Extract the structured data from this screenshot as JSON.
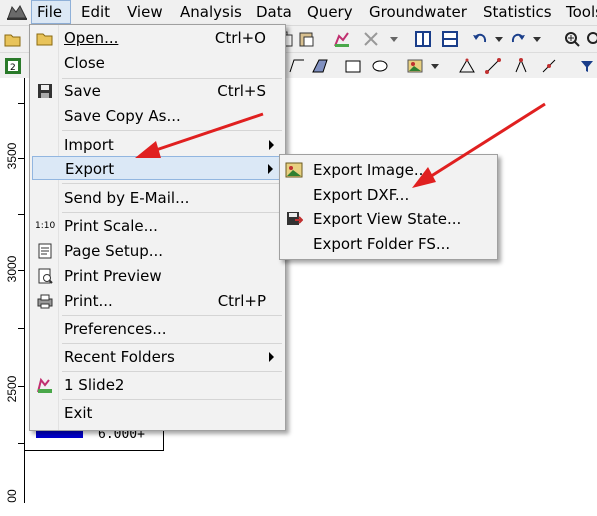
{
  "menubar": {
    "items": [
      "File",
      "Edit",
      "View",
      "Analysis",
      "Data",
      "Query",
      "Groundwater",
      "Statistics",
      "Tools"
    ]
  },
  "ruler": {
    "labels": [
      "3500",
      "3000",
      "2500",
      "00"
    ]
  },
  "legend": {
    "value": "6.000+",
    "swatch_color": "#0000cc"
  },
  "file_menu": {
    "items": [
      {
        "label": "Open...",
        "shortcut": "Ctrl+O",
        "icon": "open-folder-icon"
      },
      {
        "label": "Close",
        "shortcut": "",
        "icon": ""
      },
      {
        "label": "Save",
        "shortcut": "Ctrl+S",
        "icon": "save-icon"
      },
      {
        "label": "Save Copy As...",
        "shortcut": "",
        "icon": ""
      },
      {
        "label": "Import",
        "shortcut": "",
        "icon": "",
        "submenu": true
      },
      {
        "label": "Export",
        "shortcut": "",
        "icon": "",
        "submenu": true
      },
      {
        "label": "Send by E-Mail...",
        "shortcut": "",
        "icon": ""
      },
      {
        "label": "Print Scale...",
        "shortcut": "",
        "icon": "print-scale-icon",
        "icon_text": "1:10"
      },
      {
        "label": "Page Setup...",
        "shortcut": "",
        "icon": "page-setup-icon"
      },
      {
        "label": "Print Preview",
        "shortcut": "",
        "icon": "print-preview-icon"
      },
      {
        "label": "Print...",
        "shortcut": "Ctrl+P",
        "icon": "printer-icon"
      },
      {
        "label": "Preferences...",
        "shortcut": "",
        "icon": ""
      },
      {
        "label": "Recent Folders",
        "shortcut": "",
        "icon": "",
        "submenu": true
      },
      {
        "label": "1 Slide2",
        "shortcut": "",
        "icon": "slide-file-icon"
      },
      {
        "label": "Exit",
        "shortcut": "",
        "icon": ""
      }
    ]
  },
  "export_menu": {
    "items": [
      {
        "label": "Export Image...",
        "icon": "export-image-icon"
      },
      {
        "label": "Export DXF...",
        "icon": ""
      },
      {
        "label": "Export View State...",
        "icon": "export-view-state-icon"
      },
      {
        "label": "Export Folder FS...",
        "icon": ""
      }
    ]
  },
  "colors": {
    "highlight": "#dbe8f6",
    "highlight_border": "#92b6e0",
    "arrow": "#e02020"
  }
}
